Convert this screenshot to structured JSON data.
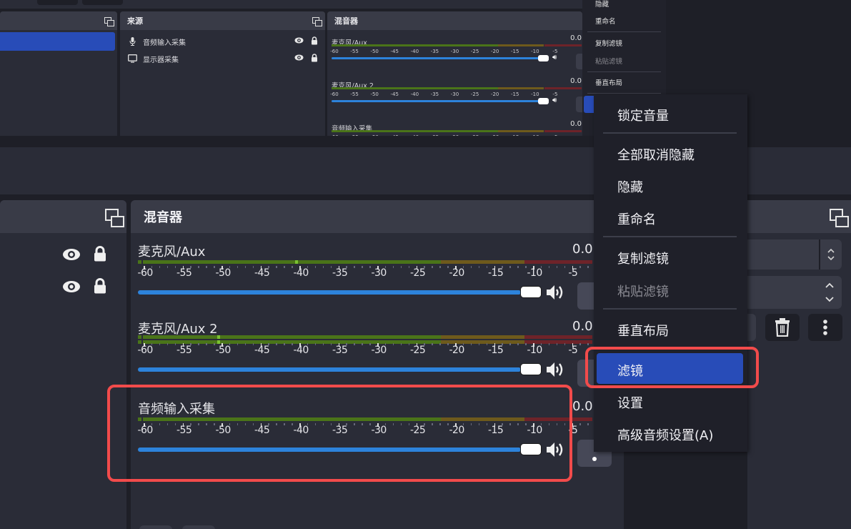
{
  "top_view": {
    "sources_panel": {
      "title": "来源",
      "items": [
        {
          "icon": "microphone-icon",
          "label": "音频输入采集",
          "visible": true,
          "locked": true
        },
        {
          "icon": "monitor-icon",
          "label": "显示器采集",
          "visible": true,
          "locked": true
        }
      ]
    },
    "mixer_panel": {
      "title": "混音器",
      "channels": [
        {
          "name": "麦克风/Aux",
          "db": "0.0"
        },
        {
          "name": "麦克风/Aux 2",
          "db": "0.0"
        },
        {
          "name": "音频输入采集",
          "db": "0.0"
        }
      ]
    },
    "context_menu_partial": {
      "items": [
        {
          "label": "隐藏",
          "disabled": false
        },
        {
          "label": "重命名",
          "disabled": false
        },
        {
          "label": "复制滤镜",
          "disabled": false
        },
        {
          "label": "粘贴滤镜",
          "disabled": true
        },
        {
          "label": "垂直布局",
          "disabled": false
        }
      ]
    }
  },
  "mixer": {
    "title": "混音器",
    "scale_ticks": [
      "-60",
      "-55",
      "-50",
      "-45",
      "-40",
      "-35",
      "-30",
      "-25",
      "-20",
      "-15",
      "-10",
      "-5"
    ],
    "channels": [
      {
        "name": "麦克风/Aux",
        "db": "0.0",
        "volume_fraction": 1.0,
        "meter_channels": 1,
        "peak_db": -40
      },
      {
        "name": "麦克风/Aux 2",
        "db": "0.0",
        "volume_fraction": 1.0,
        "meter_channels": 2,
        "peak_db": -50
      },
      {
        "name": "音频输入采集",
        "db": "0.0",
        "volume_fraction": 1.0,
        "meter_channels": 1,
        "peak_db": null
      }
    ],
    "meter_colors": {
      "green": "#4a7419",
      "yellow": "#6e5a1c",
      "red": "#6e2329",
      "peak": "#7ac231"
    },
    "fader_color": "#2d83db"
  },
  "sources_visible_rows": 2,
  "context_menu": {
    "items": [
      {
        "label": "锁定音量",
        "disabled": false,
        "highlighted": false
      },
      {
        "label": "全部取消隐藏",
        "disabled": false,
        "highlighted": false
      },
      {
        "label": "隐藏",
        "disabled": false,
        "highlighted": false
      },
      {
        "label": "重命名",
        "disabled": false,
        "highlighted": false
      },
      {
        "label": "复制滤镜",
        "disabled": false,
        "highlighted": false
      },
      {
        "label": "粘贴滤镜",
        "disabled": true,
        "highlighted": false
      },
      {
        "label": "垂直布局",
        "disabled": false,
        "highlighted": false
      },
      {
        "label": "滤镜",
        "disabled": false,
        "highlighted": true
      },
      {
        "label": "设置",
        "disabled": false,
        "highlighted": false
      },
      {
        "label": "高级音频设置(A)",
        "disabled": false,
        "highlighted": false
      }
    ],
    "highlight_color": "#284cb8"
  },
  "annotations": {
    "highlight_color": "#f24b4b"
  }
}
